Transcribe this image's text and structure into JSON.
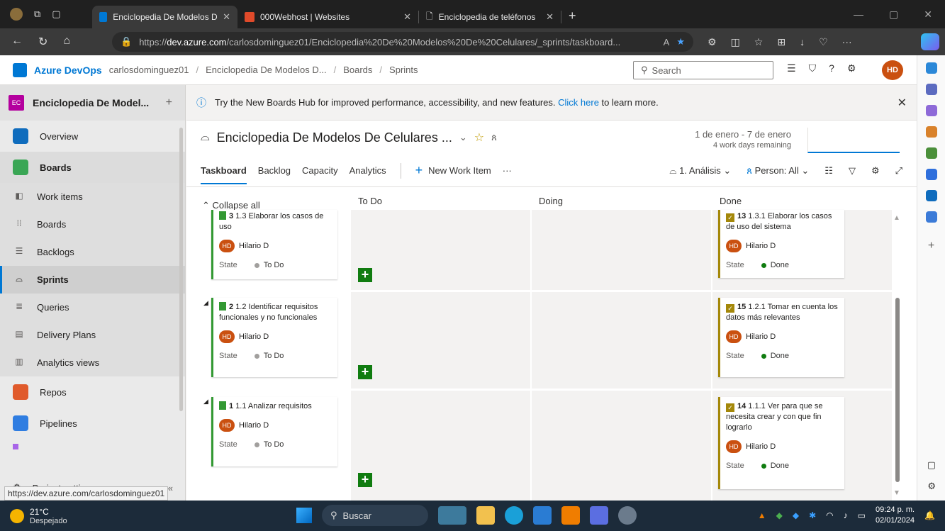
{
  "browser": {
    "tabs": [
      {
        "title": "Enciclopedia De Modelos De Celu",
        "active": true
      },
      {
        "title": "000Webhost | Websites",
        "active": false
      },
      {
        "title": "Enciclopedia de teléfonos",
        "active": false
      }
    ],
    "url_prefix": "https://",
    "url_host": "dev.azure.com",
    "url_path": "/carlosdominguez01/Enciclopedia%20De%20Modelos%20De%20Celulares/_sprints/taskboard..."
  },
  "header": {
    "brand": "Azure DevOps",
    "breadcrumbs": [
      "carlosdominguez01",
      "Enciclopedia De Modelos D...",
      "Boards",
      "Sprints"
    ],
    "search_placeholder": "Search",
    "user_initials": "HD"
  },
  "sidebar": {
    "project_badge": "EC",
    "project_name": "Enciclopedia De Model...",
    "items": [
      {
        "label": "Overview",
        "icon": "overview-icon"
      },
      {
        "label": "Boards",
        "icon": "boards-icon"
      },
      {
        "label": "Work items",
        "icon": "work-items-icon"
      },
      {
        "label": "Boards",
        "icon": "kanban-icon"
      },
      {
        "label": "Backlogs",
        "icon": "backlogs-icon"
      },
      {
        "label": "Sprints",
        "icon": "sprints-icon"
      },
      {
        "label": "Queries",
        "icon": "queries-icon"
      },
      {
        "label": "Delivery Plans",
        "icon": "delivery-plans-icon"
      },
      {
        "label": "Analytics views",
        "icon": "analytics-icon"
      },
      {
        "label": "Repos",
        "icon": "repos-icon"
      },
      {
        "label": "Pipelines",
        "icon": "pipelines-icon"
      }
    ],
    "project_settings": "Project settings",
    "status_url": "https://dev.azure.com/carlosdominguez01"
  },
  "banner": {
    "text": "Try the New Boards Hub for improved performance, accessibility, and new features.",
    "link": "Click here",
    "suffix": "to learn more."
  },
  "sprint": {
    "title": "Enciclopedia De Modelos De Celulares ...",
    "date_range": "1 de enero - 7 de enero",
    "remaining": "4 work days remaining"
  },
  "toolbar": {
    "tabs": [
      "Taskboard",
      "Backlog",
      "Capacity",
      "Analytics"
    ],
    "new_work_item": "New Work Item",
    "more": "···",
    "iteration": "1. Análisis",
    "person": "Person: All"
  },
  "board": {
    "collapse_all": "Collapse all",
    "columns": [
      "To Do",
      "Doing",
      "Done"
    ],
    "rows": [
      {
        "backlog": {
          "id": "3",
          "title": "1.3 Elaborar los casos de uso",
          "assignee": "Hilario D",
          "state_label": "State",
          "state": "To Do"
        },
        "done": {
          "id": "13",
          "title": "1.3.1 Elaborar los casos de uso del sistema",
          "assignee": "Hilario D",
          "state_label": "State",
          "state": "Done"
        }
      },
      {
        "backlog": {
          "id": "2",
          "title": "1.2 Identificar requisitos funcionales y no funcionales",
          "assignee": "Hilario D",
          "state_label": "State",
          "state": "To Do"
        },
        "done": {
          "id": "15",
          "title": "1.2.1 Tomar en cuenta los datos más relevantes",
          "assignee": "Hilario D",
          "state_label": "State",
          "state": "Done"
        }
      },
      {
        "backlog": {
          "id": "1",
          "title": "1.1 Analizar requisitos",
          "assignee": "Hilario D",
          "state_label": "State",
          "state": "To Do"
        },
        "done": {
          "id": "14",
          "title": "1.1.1 Ver para que se necesita crear y con que fin lograrlo",
          "assignee": "Hilario D",
          "state_label": "State",
          "state": "Done"
        }
      }
    ]
  },
  "taskbar": {
    "temp": "21°C",
    "weather": "Despejado",
    "search": "Buscar",
    "time": "09:24 p. m.",
    "date": "02/01/2024"
  },
  "colors": {
    "accent": "#0078d4",
    "todo": "#a19f9d",
    "done": "#107c10",
    "avatar": "#ca5010"
  }
}
